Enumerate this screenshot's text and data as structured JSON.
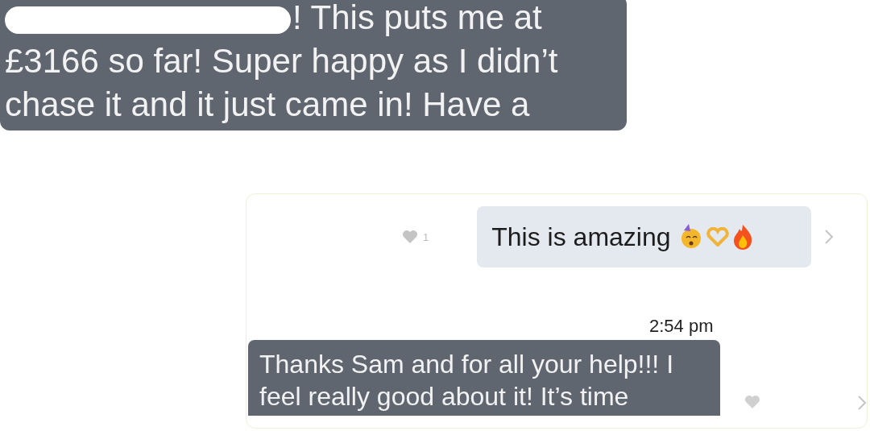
{
  "first_message": {
    "text": "! This puts me at\n£3166 so far! Super happy as I didn’t\nchase it and it just came in! Have a",
    "redacted": true
  },
  "chat": {
    "sent_message": {
      "text": "This is amazing",
      "likes": "1"
    },
    "time": "2:54 pm",
    "received_message": {
      "text": "Thanks Sam and for all your help!!! I\nfeel really good about it! It’s time"
    }
  }
}
